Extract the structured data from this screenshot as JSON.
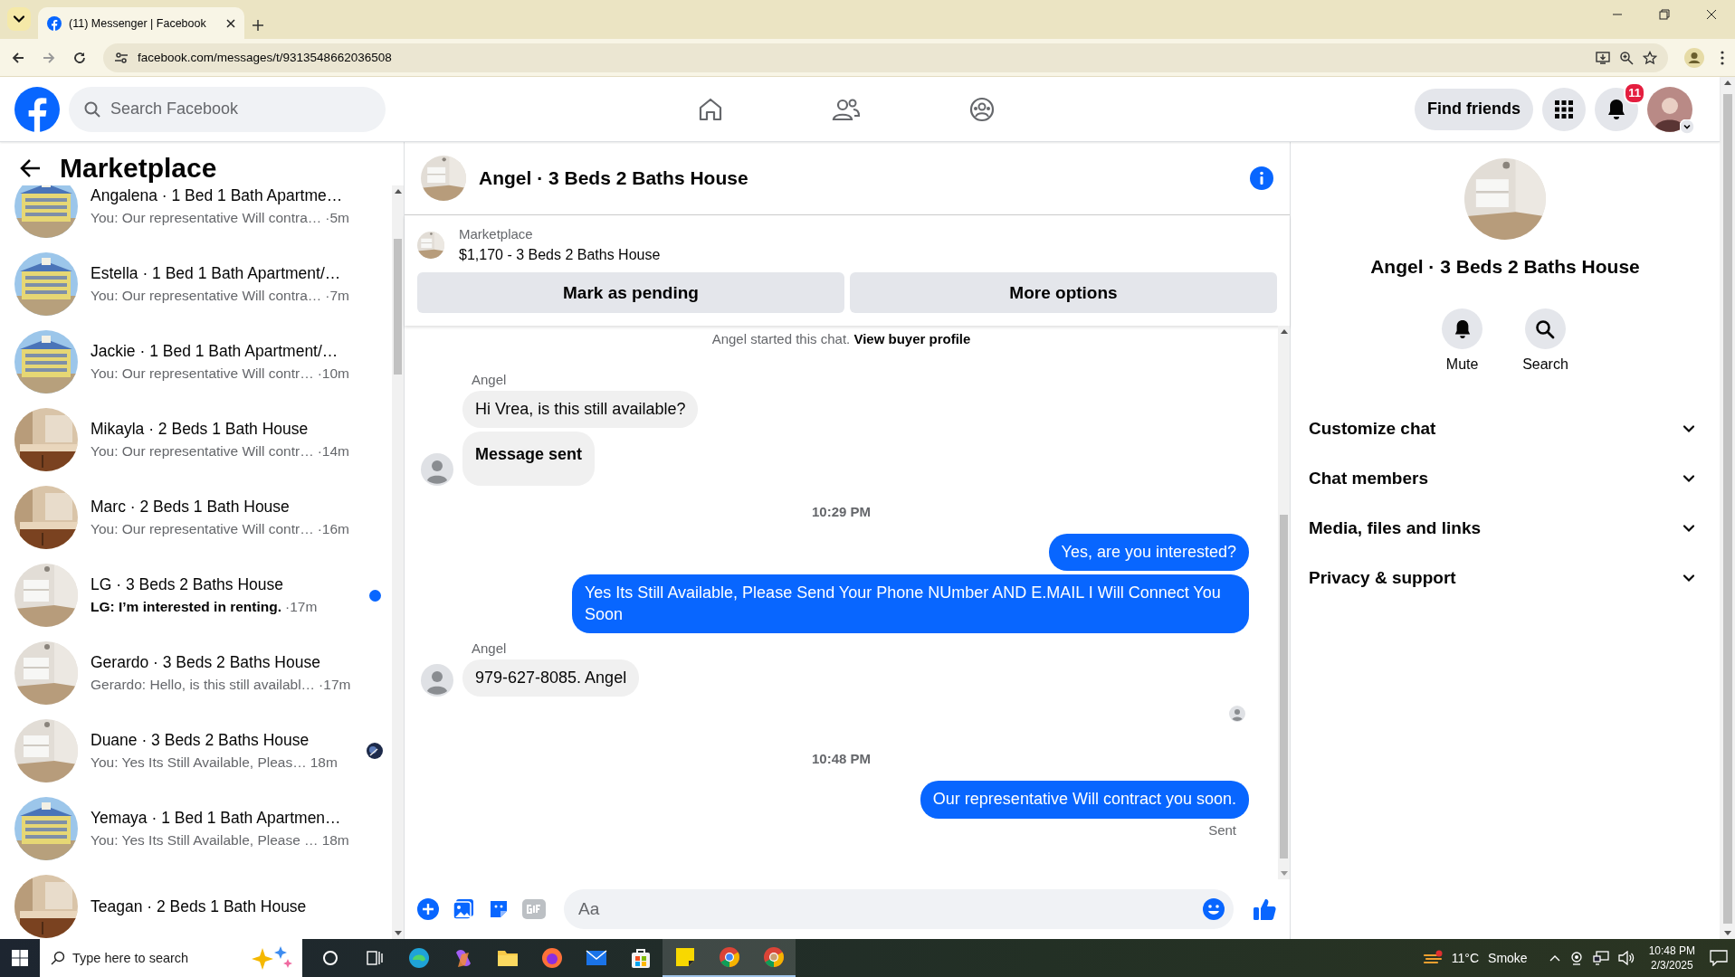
{
  "browser": {
    "tab_title": "(11) Messenger | Facebook",
    "url": "facebook.com/messages/t/9313548662036508"
  },
  "header": {
    "search_placeholder": "Search Facebook",
    "find_friends": "Find friends",
    "notification_count": "11"
  },
  "sidebar": {
    "title": "Marketplace",
    "conversations": [
      {
        "title": "Angalena · 1 Bed 1 Bath Apartme…",
        "preview": "You: Our representative Will contra…",
        "time": "·5m",
        "unread": false,
        "seen_avatar": false
      },
      {
        "title": "Estella · 1 Bed 1 Bath Apartment/…",
        "preview": "You: Our representative Will contra…",
        "time": "·7m",
        "unread": false,
        "seen_avatar": false
      },
      {
        "title": "Jackie · 1 Bed 1 Bath Apartment/…",
        "preview": "You: Our representative Will contr…",
        "time": "·10m",
        "unread": false,
        "seen_avatar": false
      },
      {
        "title": "Mikayla · 2 Beds 1 Bath House",
        "preview": "You: Our representative Will contr…",
        "time": "·14m",
        "unread": false,
        "seen_avatar": false
      },
      {
        "title": "Marc · 2 Beds 1 Bath House",
        "preview": "You: Our representative Will contr…",
        "time": "·16m",
        "unread": false,
        "seen_avatar": false
      },
      {
        "title": "LG · 3 Beds 2 Baths House",
        "preview": "LG: I’m interested in renting.",
        "time": "·17m",
        "unread": true,
        "seen_avatar": false
      },
      {
        "title": "Gerardo · 3 Beds 2 Baths House",
        "preview": "Gerardo: Hello, is this still availabl…",
        "time": "·17m",
        "unread": false,
        "seen_avatar": false
      },
      {
        "title": "Duane · 3 Beds 2 Baths House",
        "preview": "You: Yes Its Still Available, Pleas…",
        "time": "18m",
        "unread": false,
        "seen_avatar": true
      },
      {
        "title": "Yemaya · 1 Bed 1 Bath Apartmen…",
        "preview": "You: Yes Its Still Available, Please …",
        "time": "18m",
        "unread": false,
        "seen_avatar": false
      },
      {
        "title": "Teagan · 2 Beds 1 Bath House",
        "unread": false,
        "seen_avatar": false
      }
    ]
  },
  "chat": {
    "title": "Angel · 3 Beds 2 Baths House",
    "listing": {
      "source": "Marketplace",
      "price_title": "$1,170 - 3 Beds 2 Baths House",
      "buttons": [
        "Mark as pending",
        "More options"
      ]
    },
    "messages": [
      {
        "kind": "notice",
        "text": "Angel started this chat.",
        "link": "View buyer profile"
      },
      {
        "kind": "sender",
        "text": "Angel"
      },
      {
        "kind": "incoming",
        "text": "Hi Vrea, is this still available?",
        "bold": false,
        "avatar": false
      },
      {
        "kind": "incoming",
        "text": "Message sent",
        "bold": true,
        "avatar": true
      },
      {
        "kind": "time",
        "text": "10:29 PM"
      },
      {
        "kind": "outgoing",
        "text": "Yes, are you interested?"
      },
      {
        "kind": "outgoing",
        "text": "Yes Its Still Available, Please Send Your Phone NUmber AND E.MAIL I Will Connect You Soon"
      },
      {
        "kind": "sender",
        "text": "Angel"
      },
      {
        "kind": "incoming",
        "text": "979-627-8085. Angel",
        "bold": false,
        "avatar": true
      },
      {
        "kind": "read"
      },
      {
        "kind": "time",
        "text": "10:48 PM"
      },
      {
        "kind": "outgoing",
        "text": "Our representative Will contract you soon."
      },
      {
        "kind": "status",
        "text": "Sent"
      }
    ],
    "composer": {
      "placeholder": "Aa"
    }
  },
  "details": {
    "title": "Angel · 3 Beds 2 Baths House",
    "actions": [
      {
        "kind": "bell",
        "label": "Mute"
      },
      {
        "kind": "search",
        "label": "Search"
      }
    ],
    "sections": [
      {
        "label": "Customize chat",
        "expanded": false
      },
      {
        "label": "Chat members",
        "expanded": false
      },
      {
        "label": "Media, files and links",
        "expanded": false
      },
      {
        "label": "Privacy & support",
        "expanded": false
      }
    ]
  },
  "taskbar": {
    "search_placeholder": "Type here to search",
    "temperature": "11°C",
    "weather": "Smoke",
    "time": "10:48 PM",
    "date": "2/3/2025"
  }
}
